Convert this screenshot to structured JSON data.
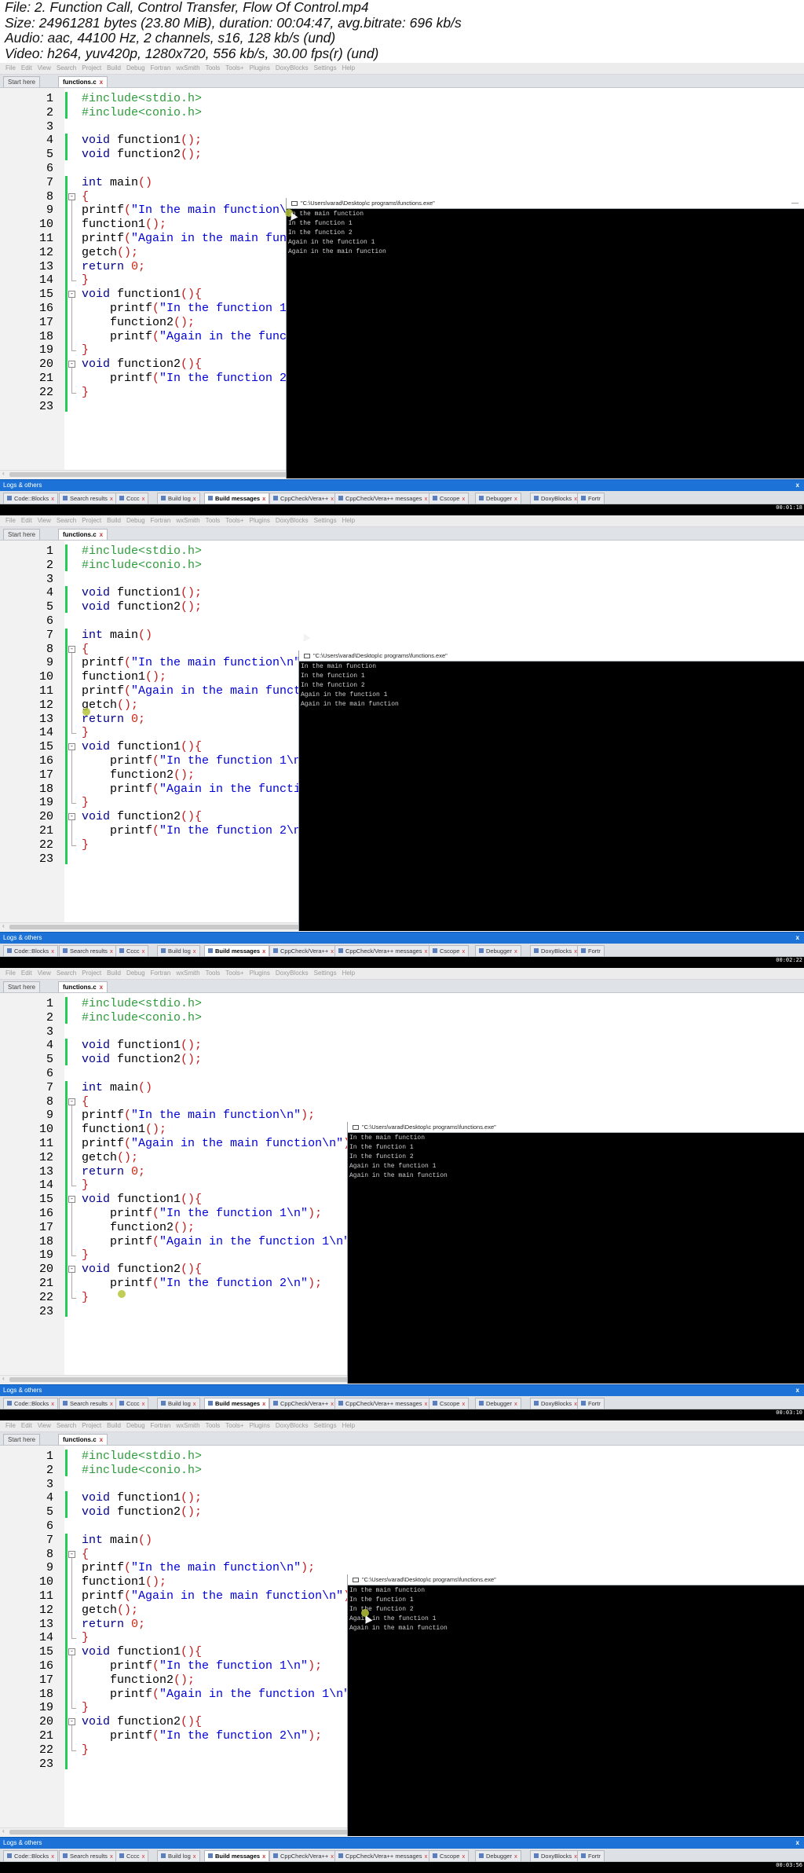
{
  "header": {
    "line1": "File: 2. Function Call, Control Transfer, Flow Of Control.mp4",
    "line2": "Size: 24961281 bytes (23.80 MiB), duration: 00:04:47, avg.bitrate: 696 kb/s",
    "line3": "Audio: aac, 44100 Hz, 2 channels, s16, 128 kb/s (und)",
    "line4": "Video: h264, yuv420p, 1280x720, 556 kb/s, 30.00 fps(r) (und)"
  },
  "menu": [
    "File",
    "Edit",
    "View",
    "Search",
    "Project",
    "Build",
    "Debug",
    "Fortran",
    "wxSmith",
    "Tools",
    "Tools+",
    "Plugins",
    "DoxyBlocks",
    "Settings",
    "Help"
  ],
  "file_tabs": {
    "start": "Start here",
    "file": "functions.c",
    "close": "x"
  },
  "line_numbers": [
    "1",
    "2",
    "3",
    "4",
    "5",
    "6",
    "7",
    "8",
    "9",
    "10",
    "11",
    "12",
    "13",
    "14",
    "15",
    "16",
    "17",
    "18",
    "19",
    "20",
    "21",
    "22",
    "23"
  ],
  "console": {
    "title": "\"C:\\Users\\varad\\Desktop\\c programs\\functions.exe\"",
    "minimize": "—",
    "lines": [
      "In the main function",
      "In the function 1",
      "In the function 2",
      "Again in the function 1",
      "Again in the main function"
    ]
  },
  "logs": {
    "title": "Logs & others",
    "close": "x"
  },
  "bottom_tabs": [
    "Code::Blocks",
    "Search results",
    "Cccc",
    "Build log",
    "Build messages",
    "CppCheck/Vera++",
    "CppCheck/Vera++ messages",
    "Cscope",
    "Debugger",
    "DoxyBlocks",
    "Fortr"
  ],
  "tab_close": "x",
  "frames": [
    {
      "stamp": "00:01:18"
    },
    {
      "stamp": "00:02:22"
    },
    {
      "stamp": "00:03:10"
    },
    {
      "stamp": "00:03:56"
    }
  ]
}
